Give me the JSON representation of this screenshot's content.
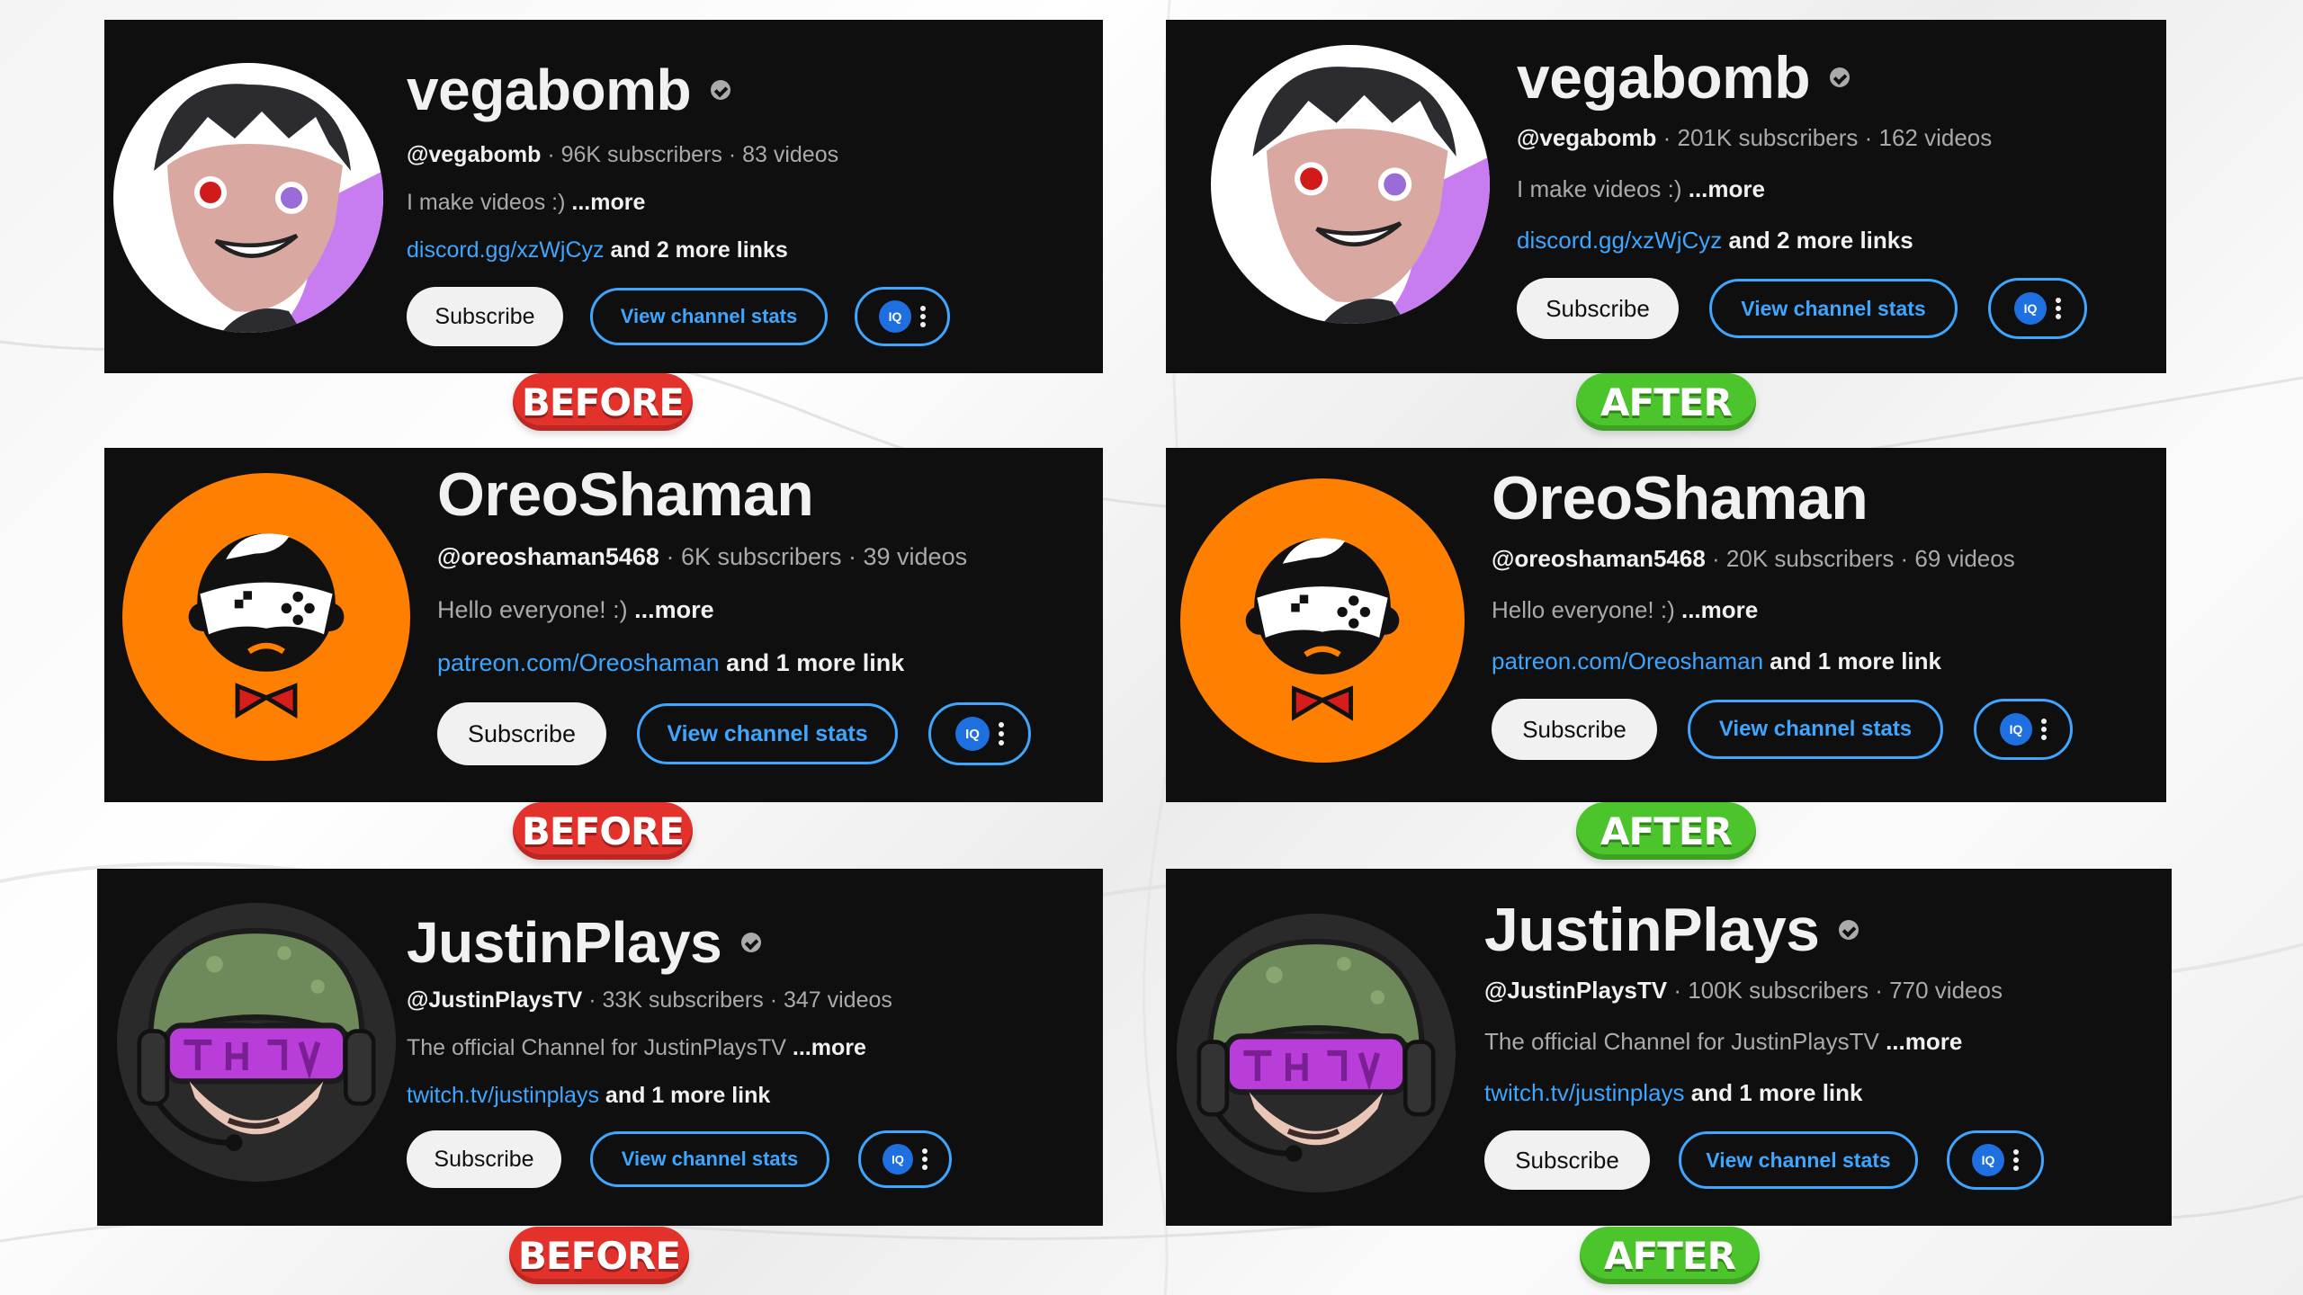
{
  "colors": {
    "card_bg": "#0f0f0f",
    "link": "#3ea6ff",
    "before": "#e3312b",
    "after": "#4cc52c"
  },
  "rows": [
    {
      "before": {
        "name": "vegabomb",
        "verified": true,
        "handle": "@vegabomb",
        "stats": " · 96K subscribers · 83 videos",
        "desc": "I make videos :) ",
        "more": "...more",
        "link": "discord.gg/xzWjCyz",
        "link_rest": " and 2 more links",
        "subscribe": "Subscribe",
        "stats_btn": "View channel stats",
        "ext_icon": "IQ",
        "avatar": "anime-character-avatar",
        "badge": "BEFORE"
      },
      "after": {
        "name": "vegabomb",
        "verified": true,
        "handle": "@vegabomb",
        "stats": " · 201K subscribers · 162 videos",
        "desc": "I make videos :) ",
        "more": "...more",
        "link": "discord.gg/xzWjCyz",
        "link_rest": " and 2 more links",
        "subscribe": "Subscribe",
        "stats_btn": "View channel stats",
        "ext_icon": "IQ",
        "avatar": "anime-character-avatar",
        "badge": "AFTER"
      }
    },
    {
      "before": {
        "name": "OreoShaman",
        "verified": false,
        "handle": "@oreoshaman5468",
        "stats": " · 6K subscribers · 39 videos",
        "desc": "Hello everyone!  :) ",
        "more": "...more",
        "link": "patreon.com/Oreoshaman",
        "link_rest": " and 1 more link",
        "subscribe": "Subscribe",
        "stats_btn": "View channel stats",
        "ext_icon": "IQ",
        "avatar": "gamepad-mascot-avatar",
        "badge": "BEFORE"
      },
      "after": {
        "name": "OreoShaman",
        "verified": false,
        "handle": "@oreoshaman5468",
        "stats": " · 20K subscribers · 69 videos",
        "desc": "Hello everyone!  :) ",
        "more": "...more",
        "link": "patreon.com/Oreoshaman",
        "link_rest": " and 1 more link",
        "subscribe": "Subscribe",
        "stats_btn": "View channel stats",
        "ext_icon": "IQ",
        "avatar": "gamepad-mascot-avatar",
        "badge": "AFTER"
      }
    },
    {
      "before": {
        "name": "JustinPlays",
        "verified": true,
        "handle": "@JustinPlaysTV",
        "stats": " · 33K subscribers · 347 videos",
        "desc": "The official Channel for JustinPlaysTV ",
        "more": "...more",
        "link": "twitch.tv/justinplays",
        "link_rest": " and 1 more link",
        "subscribe": "Subscribe",
        "stats_btn": "View channel stats",
        "ext_icon": "IQ",
        "avatar": "helmet-soldier-avatar",
        "badge": "BEFORE"
      },
      "after": {
        "name": "JustinPlays",
        "verified": true,
        "handle": "@JustinPlaysTV",
        "stats": " · 100K subscribers · 770 videos",
        "desc": "The official Channel for JustinPlaysTV ",
        "more": "...more",
        "link": "twitch.tv/justinplays",
        "link_rest": " and 1 more link",
        "subscribe": "Subscribe",
        "stats_btn": "View channel stats",
        "ext_icon": "IQ",
        "avatar": "helmet-soldier-avatar",
        "badge": "AFTER"
      }
    }
  ]
}
